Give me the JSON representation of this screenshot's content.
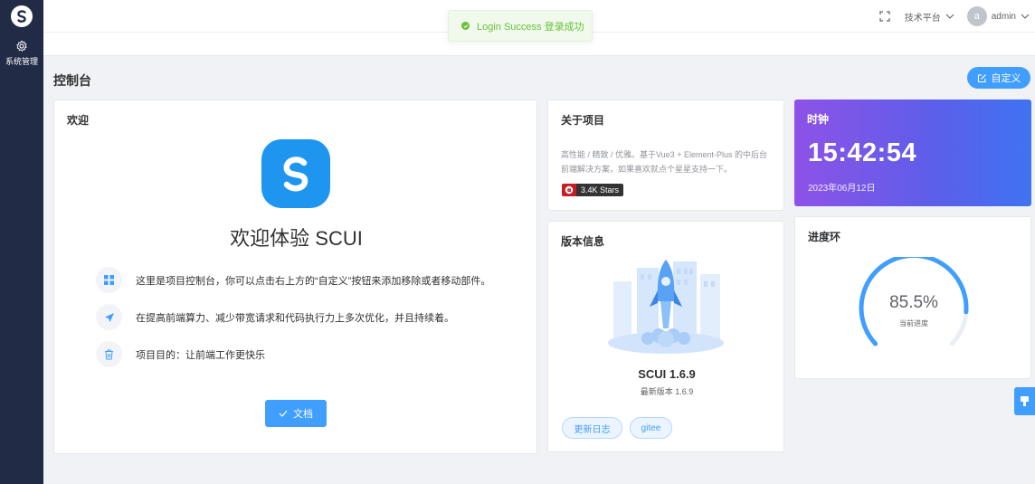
{
  "sidebar": {
    "nav_items": [
      {
        "label": "系统管理",
        "icon": "gear-icon"
      }
    ]
  },
  "header": {
    "fullscreen_icon": "fullscreen-icon",
    "platform_menu": "技术平台",
    "user": {
      "avatar_letter": "a",
      "name": "admin"
    }
  },
  "toast": {
    "message": "Login Success 登录成功",
    "color": "#67c23a"
  },
  "page": {
    "title": "控制台",
    "customize_button": "自定义"
  },
  "welcome": {
    "title": "欢迎",
    "headline": "欢迎体验 SCUI",
    "features": [
      {
        "icon": "grid-icon",
        "text": "这里是项目控制台，你可以点击右上方的“自定义”按钮来添加移除或者移动部件。"
      },
      {
        "icon": "send-icon",
        "text": "在提高前端算力、减少带宽请求和代码执行力上多次优化，并且持续着。"
      },
      {
        "icon": "trash-icon",
        "text": "项目目的：让前端工作更快乐"
      }
    ],
    "docs_button": "文档"
  },
  "about": {
    "title": "关于项目",
    "description": "高性能 / 精致 / 优雅。基于Vue3 + Element-Plus 的中后台前端解决方案，如果喜欢就点个星星支持一下。",
    "badge_text": "3.4K Stars"
  },
  "version": {
    "title": "版本信息",
    "name": "SCUI 1.6.9",
    "latest": "最新版本 1.6.9",
    "buttons": [
      "更新日志",
      "gitee"
    ]
  },
  "clock": {
    "title": "时钟",
    "time": "15:42:54",
    "date": "2023年06月12日"
  },
  "progress": {
    "title": "进度环",
    "value_text": "85.5%",
    "value": 85.5,
    "label": "当前进度",
    "color": "#409eff"
  },
  "colors": {
    "accent": "#409eff",
    "sidebar": "#222b45"
  }
}
